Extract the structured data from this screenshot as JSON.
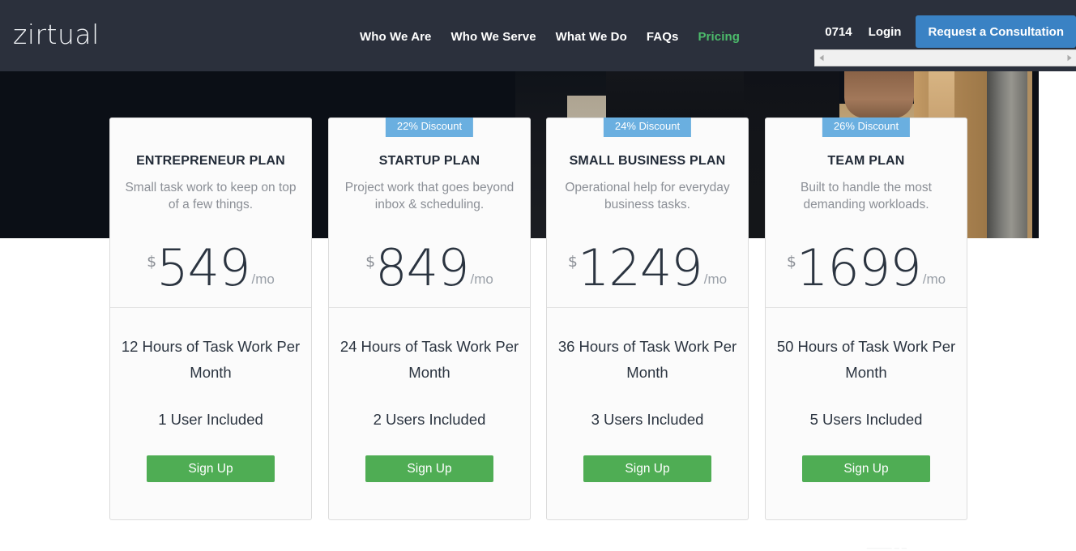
{
  "header": {
    "logo": "zirtual",
    "nav": [
      {
        "label": "Who We Are",
        "active": false
      },
      {
        "label": "Who We Serve",
        "active": false
      },
      {
        "label": "What We Do",
        "active": false
      },
      {
        "label": "FAQs",
        "active": false
      },
      {
        "label": "Pricing",
        "active": true
      }
    ],
    "phone": "0714",
    "login_label": "Login",
    "cta_label": "Request a Consultation",
    "bg_color": "#2b303c",
    "cta_color": "#3a82c4",
    "active_nav_color": "#4CBB6B"
  },
  "scrollbar": {
    "left_arrow": "scroll-left-arrow",
    "right_arrow": "scroll-right-arrow"
  },
  "pricing": {
    "currency_symbol": "$",
    "period_suffix": "/mo",
    "signup_label": "Sign Up",
    "badge_color": "#6aafe0",
    "signup_color": "#4fad54",
    "plans": [
      {
        "badge": "",
        "name": "ENTREPRENEUR PLAN",
        "description": "Small task work to keep on top of a few things.",
        "price": "549",
        "hours": "12 Hours of Task Work Per Month",
        "users": "1 User Included"
      },
      {
        "badge": "22% Discount",
        "name": "STARTUP PLAN",
        "description": "Project work that goes beyond inbox & scheduling.",
        "price": "849",
        "hours": "24 Hours of Task Work Per Month",
        "users": "2 Users Included"
      },
      {
        "badge": "24% Discount",
        "name": "SMALL BUSINESS PLAN",
        "description": "Operational help for everyday business tasks.",
        "price": "1249",
        "hours": "36 Hours of Task Work Per Month",
        "users": "3 Users Included"
      },
      {
        "badge": "26% Discount",
        "name": "TEAM PLAN",
        "description": "Built to handle the most demanding workloads.",
        "price": "1699",
        "hours": "50 Hours of Task Work Per Month",
        "users": "5 Users Included"
      }
    ]
  },
  "footer": {
    "ghost_text": "_____        _              _"
  }
}
